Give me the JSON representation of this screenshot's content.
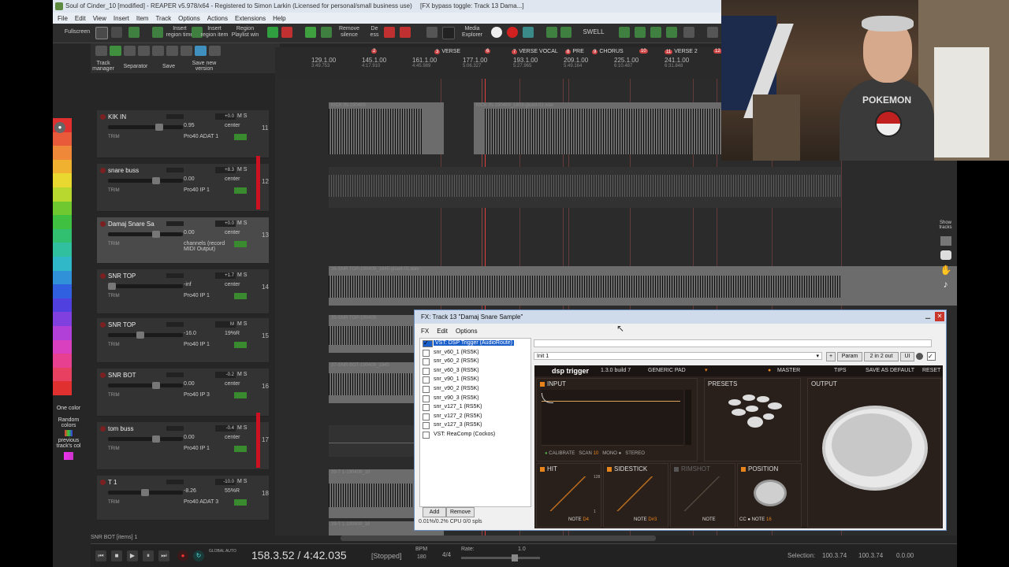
{
  "window_title": "Soul of Cinder_10 [modified] - REAPER v5.978/x64 - Registered to Simon Larkin (Licensed for personal/small business use)",
  "fx_bypass_note": "[FX bypass toggle: Track 13 Dama...]",
  "menu": [
    "File",
    "Edit",
    "View",
    "Insert",
    "Item",
    "Track",
    "Options",
    "Actions",
    "Extensions",
    "Help"
  ],
  "toolbar1": {
    "fullscreen": "Fullscreen",
    "insert_region_time": "Insert region time",
    "insert_region_item": "Insert region item",
    "region_playlist": "Region Playlist win",
    "remove_silence": "Remove silence",
    "de_ess": "De ess",
    "media_explorer": "Media Explorer",
    "swell": "SWELL"
  },
  "toolbar2": {
    "track_manager": "Track manager",
    "separator": "Separator",
    "save": "Save",
    "save_new_version": "Save new version"
  },
  "ruler": {
    "regions": [
      {
        "num": "2",
        "label": ""
      },
      {
        "num": "3",
        "label": "VERSE"
      },
      {
        "num": "6",
        "label": ""
      },
      {
        "num": "7",
        "label": "VERSE VOCAL"
      },
      {
        "num": "8",
        "label": "PRE"
      },
      {
        "num": "9",
        "label": "CHORUS"
      },
      {
        "num": "10",
        "label": ""
      },
      {
        "num": "11",
        "label": "VERSE 2"
      },
      {
        "num": "12",
        "label": ""
      }
    ],
    "marks": [
      {
        "bar": "129.1.00",
        "time": "3:49.753"
      },
      {
        "bar": "145.1.00",
        "time": "4:17.910"
      },
      {
        "bar": "161.1.00",
        "time": "4:45.989"
      },
      {
        "bar": "177.1.00",
        "time": "5:06.327"
      },
      {
        "bar": "193.1.00",
        "time": "5:27.965"
      },
      {
        "bar": "209.1.00",
        "time": "5:49.164"
      },
      {
        "bar": "225.1.00",
        "time": "6:10.487"
      },
      {
        "bar": "241.1.00",
        "time": "6:31.848"
      }
    ]
  },
  "tracks": [
    {
      "num": "11",
      "name": "KIK IN",
      "vol": "+0.0",
      "fader": "0.95",
      "pan": "center",
      "io": "Pro40 ADAT 1"
    },
    {
      "num": "12",
      "name": "snare buss",
      "vol": "+8.3",
      "fader": "0.00",
      "pan": "center",
      "io": "Pro40 IP 1"
    },
    {
      "num": "13",
      "name": "Damaj Snare Sa",
      "vol": "+0.0",
      "fader": "0.00",
      "pan": "center",
      "io": "channels (record MIDI Output)"
    },
    {
      "num": "14",
      "name": "SNR TOP",
      "vol": "+1.7",
      "fader": "-inf",
      "pan": "center",
      "io": "Pro40 IP 1"
    },
    {
      "num": "15",
      "name": "SNR TOP",
      "vol": "M",
      "fader": "-16.0",
      "pan": "19%R",
      "io": "Pro40 IP 1"
    },
    {
      "num": "16",
      "name": "SNR BOT",
      "vol": "-0.2",
      "fader": "0.00",
      "pan": "center",
      "io": "Pro40 IP 3"
    },
    {
      "num": "17",
      "name": "tom buss",
      "vol": "-0.4",
      "fader": "0.00",
      "pan": "center",
      "io": "Pro40 IP 1"
    },
    {
      "num": "18",
      "name": "T 1",
      "vol": "-10.0",
      "fader": "-8.26",
      "pan": "55%R",
      "io": "Pro40 ADAT 3"
    }
  ],
  "track_common": {
    "master": "MASTER",
    "trim": "TRIM"
  },
  "items": {
    "kik1": "KICK IN-190409",
    "kik2": "KICK IN-190409_1803-glued-01.wav",
    "snr_top": "36-SNR TOP-190409_1845-glued-01.wav",
    "snr_top2": "35-SNR TOP-190409",
    "snr_bot": "37-SNR BOT-190409_1845",
    "t1": "39-T 1-190409_18",
    "t1b": "39-T 1-190409_18"
  },
  "left_panel": {
    "one_color": "One color",
    "random_colors": "Random colors",
    "previous_track_col": "previous track's col"
  },
  "transport": {
    "position": "158.3.52 / 4:42.035",
    "state": "[Stopped]",
    "bpm_label": "BPM",
    "bpm": "180",
    "timesig": "4/4",
    "rate_label": "Rate:",
    "rate": "1.0",
    "global_auto": "GLOBAL AUTO",
    "selection_label": "Selection:",
    "sel_start": "100.3.74",
    "sel_end": "100.3.74",
    "sel_len": "0.0.00",
    "status": "SNR BOT [items] 1"
  },
  "right_strip": {
    "show_tracks": "Show tracks"
  },
  "fx_window": {
    "title": "FX: Track 13 \"Damaj Snare Sample\"",
    "menu": [
      "FX",
      "Edit",
      "Options"
    ],
    "chain": [
      {
        "name": "VST: DSP Trigger (AudioRoute)",
        "checked": true,
        "selected": true
      },
      {
        "name": "snr_v60_1 (RS5K)",
        "checked": false
      },
      {
        "name": "snr_v60_2 (RS5K)",
        "checked": false
      },
      {
        "name": "snr_v60_3 (RS5K)",
        "checked": false
      },
      {
        "name": "snr_v90_1 (RS5K)",
        "checked": false
      },
      {
        "name": "snr_v90_2 (RS5K)",
        "checked": false
      },
      {
        "name": "snr_v90_3 (RS5K)",
        "checked": false
      },
      {
        "name": "snr_v127_1 (RS5K)",
        "checked": false
      },
      {
        "name": "snr_v127_2 (RS5K)",
        "checked": false
      },
      {
        "name": "snr_v127_3 (RS5K)",
        "checked": false
      },
      {
        "name": "VST: ReaComp (Cockos)",
        "checked": false
      }
    ],
    "add": "Add",
    "remove": "Remove",
    "cpu": "0.01%/0.2% CPU 0/0 spls",
    "preset": "Init 1",
    "param": "Param",
    "io": "2 in 2 out",
    "ui": "UI"
  },
  "plugin": {
    "name": "dsp trigger",
    "version": "1.3.0 build 7",
    "pad": "GENERIC PAD",
    "master": "MASTER",
    "tips": "TIPS",
    "save_default": "SAVE AS DEFAULT",
    "reset": "RESET",
    "input": "INPUT",
    "presets": "PRESETS",
    "output": "OUTPUT",
    "calibrate": "CALIBRATE",
    "scan": "SCAN",
    "scan_val": "10",
    "mono": "MONO",
    "stereo": "STEREO",
    "hit": "HIT",
    "sidestick": "SIDESTICK",
    "rimshot": "RIMSHOT",
    "position": "POSITION",
    "note": "NOTE",
    "note1": "D4",
    "note2": "D#3",
    "note3": "",
    "cc": "CC",
    "note4": "16",
    "hit_max": "128",
    "hit_min": "1"
  },
  "webcam_shirt": "POKEMON",
  "palette": [
    "#e03030",
    "#e85a3a",
    "#f0883a",
    "#f0b030",
    "#e8d830",
    "#b8d830",
    "#70c830",
    "#40c040",
    "#30c070",
    "#30c0a0",
    "#30b8c8",
    "#3090d8",
    "#3060e0",
    "#5040e0",
    "#8040e0",
    "#b040d8",
    "#d840c0",
    "#e84090",
    "#e84060",
    "#e03030"
  ]
}
